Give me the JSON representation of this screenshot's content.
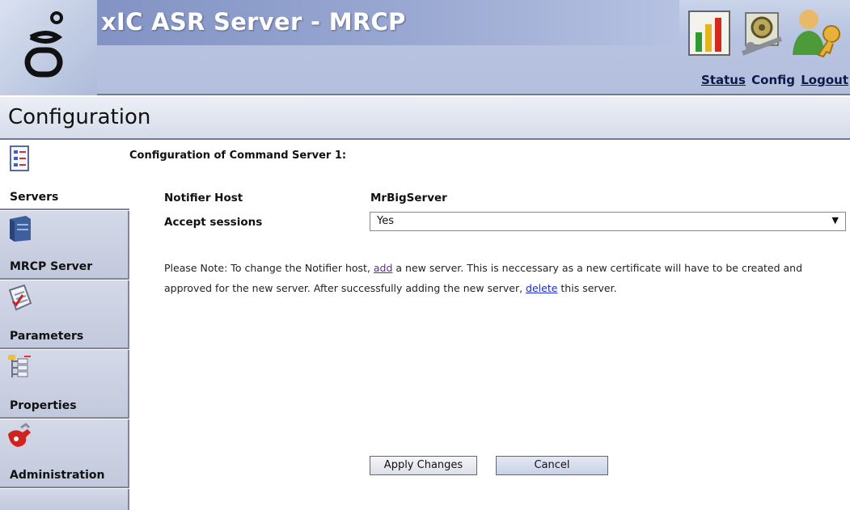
{
  "header": {
    "app_title": "xIC ASR Server - MRCP",
    "icons": [
      "status-chart-icon",
      "config-gears-icon",
      "logout-user-key-icon"
    ],
    "nav": {
      "status": "Status",
      "config": "Config",
      "logout": "Logout"
    }
  },
  "section": {
    "title": "Configuration"
  },
  "sidebar": {
    "items": [
      {
        "label": "Servers",
        "icon": "servers-checklist-icon",
        "active": true
      },
      {
        "label": "MRCP Server",
        "icon": "server-tower-icon"
      },
      {
        "label": "Parameters",
        "icon": "parameters-document-icon"
      },
      {
        "label": "Properties",
        "icon": "properties-tree-icon"
      },
      {
        "label": "Administration",
        "icon": "administration-tools-icon"
      }
    ]
  },
  "main": {
    "heading": "Configuration of Command Server 1:",
    "notifier_host_label": "Notifier Host",
    "notifier_host_value": "MrBigServer",
    "accept_sessions_label": "Accept sessions",
    "accept_sessions_value": "Yes",
    "note": {
      "part1": "Please Note: To change the Notifier host, ",
      "link_add": "add",
      "part2": " a new server. This is neccessary as a new certificate will have to be created and approved for the new server. After successfully adding the new server, ",
      "link_delete": "delete",
      "part3": " this server."
    },
    "apply_label": "Apply Changes",
    "cancel_label": "Cancel"
  }
}
